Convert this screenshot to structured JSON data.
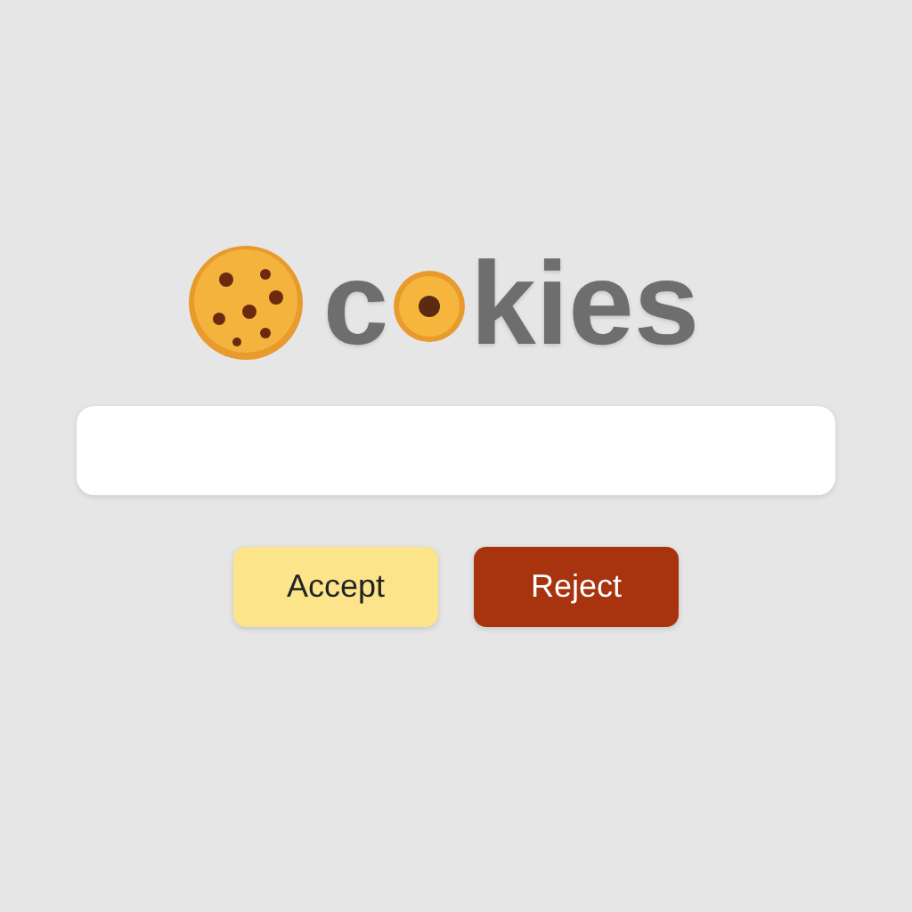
{
  "title": {
    "lead": "c",
    "tail": "kies"
  },
  "buttons": [
    {
      "label": "Accept",
      "kind": "accept"
    },
    {
      "label": "Reject",
      "kind": "reject"
    }
  ]
}
